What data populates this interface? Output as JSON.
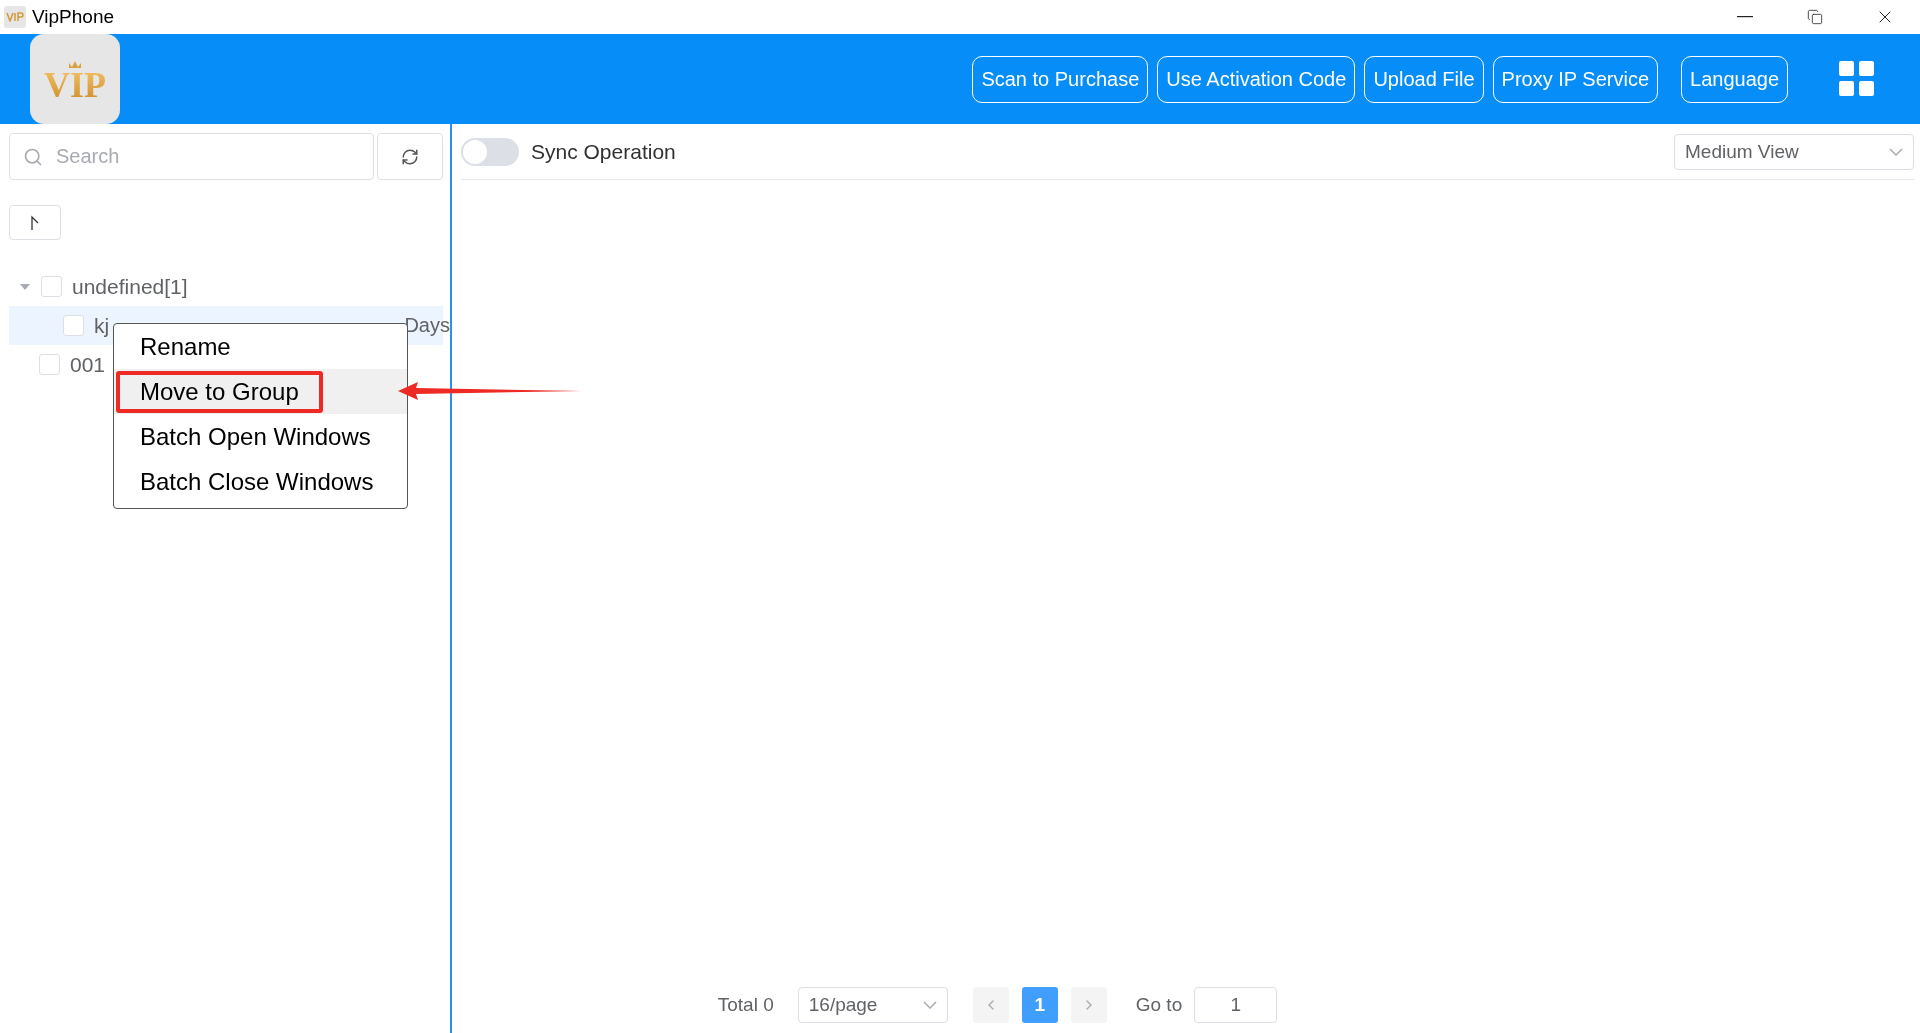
{
  "window": {
    "title": "VipPhone"
  },
  "header": {
    "logo": "VIP",
    "buttons": [
      "Scan to Purchase",
      "Use Activation Code",
      "Upload File",
      "Proxy IP Service",
      "Language"
    ]
  },
  "sidebar": {
    "search": {
      "placeholder": "Search"
    },
    "tree": [
      {
        "label": "undefined[1]",
        "expanded": true,
        "checked": false,
        "children": [
          {
            "label": "kj",
            "expiry": "Days",
            "checked": false,
            "selected": true
          }
        ]
      },
      {
        "label": "001",
        "checked": false,
        "selected": false
      }
    ]
  },
  "context_menu": {
    "items": [
      {
        "label": "Rename",
        "highlighted": false
      },
      {
        "label": "Move to Group",
        "highlighted": true
      },
      {
        "label": "Batch Open Windows",
        "highlighted": false
      },
      {
        "label": "Batch Close Windows",
        "highlighted": false
      }
    ]
  },
  "toolbar": {
    "sync": {
      "label": "Sync Operation",
      "on": false
    },
    "view": "Medium View"
  },
  "pagination": {
    "total": "Total 0",
    "page_size": "16/page",
    "pages": [
      {
        "label": "1",
        "selected": true
      }
    ],
    "goto_label": "Go to",
    "goto_value": "1"
  }
}
